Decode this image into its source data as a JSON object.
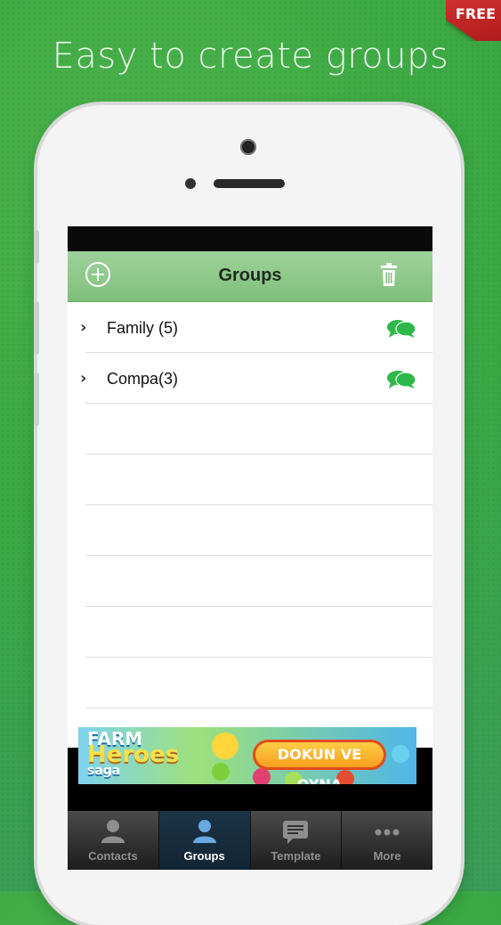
{
  "headline": "Easy to create groups",
  "badge": "FREE",
  "navbar": {
    "title": "Groups"
  },
  "groups": [
    {
      "label": "Family (5)"
    },
    {
      "label": "Compa(3)"
    }
  ],
  "ad": {
    "logo_line1": "FARM",
    "logo_line2": "Heroes",
    "logo_line3": "saga",
    "cta": "DOKUN VE OYNA"
  },
  "tabs": [
    {
      "label": "Contacts",
      "icon": "contact-icon"
    },
    {
      "label": "Groups",
      "icon": "group-icon",
      "active": true
    },
    {
      "label": "Template",
      "icon": "message-icon"
    },
    {
      "label": "More",
      "icon": "more-icon"
    }
  ],
  "colors": {
    "background": "#3aa843",
    "navbar": "#8fca8b",
    "accent": "#2fb84a"
  }
}
